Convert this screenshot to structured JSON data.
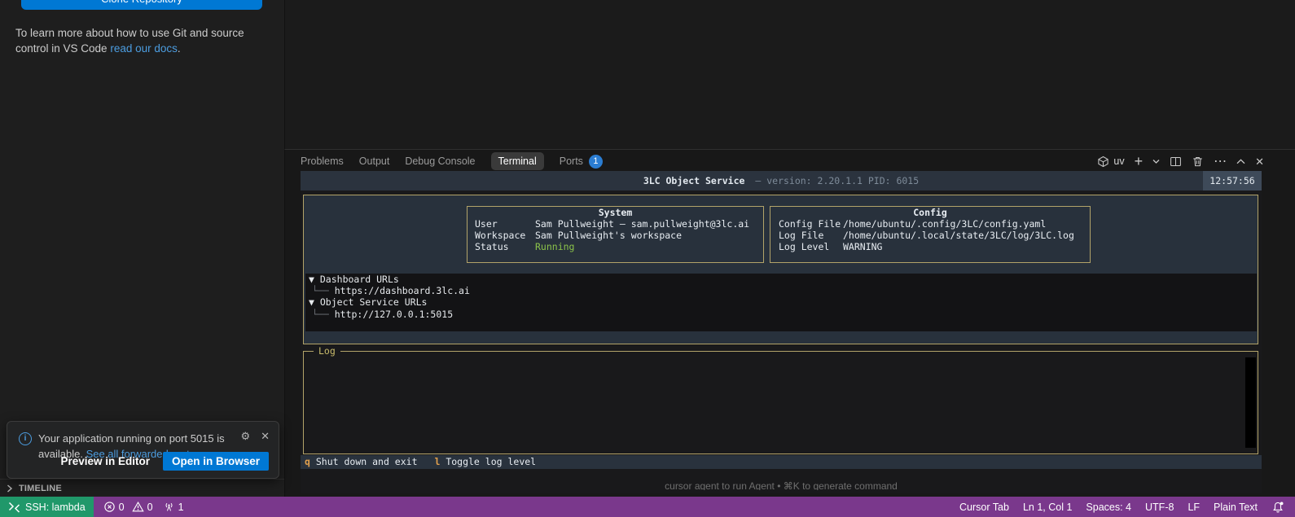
{
  "sidebar": {
    "clone_button": "Clone Repository",
    "git_help_text": "To learn more about how to use Git and source control in VS Code",
    "git_help_link": "read our docs",
    "git_help_suffix": ".",
    "timeline_label": "TIMELINE"
  },
  "notification": {
    "message": "Your application running on port 5015 is available.",
    "link": "See all forwarded ports",
    "secondary_button": "Preview in Editor",
    "primary_button": "Open in Browser"
  },
  "panel": {
    "tabs": [
      {
        "label": "Problems",
        "active": false
      },
      {
        "label": "Output",
        "active": false
      },
      {
        "label": "Debug Console",
        "active": false
      },
      {
        "label": "Terminal",
        "active": true
      },
      {
        "label": "Ports",
        "active": false,
        "badge": "1"
      }
    ],
    "profile_label": "uv"
  },
  "terminal": {
    "header": {
      "title": "3LC Object Service",
      "version_info": "— version: 2.20.1.1 PID: 6015",
      "clock": "12:57:56"
    },
    "system_panel": {
      "title": "System",
      "rows": [
        {
          "label": "User",
          "value": "Sam Pullweight — sam.pullweight@3lc.ai"
        },
        {
          "label": "Workspace",
          "value": "Sam Pullweight's workspace"
        },
        {
          "label": "Status",
          "value": "Running"
        }
      ]
    },
    "config_panel": {
      "title": "Config",
      "rows": [
        {
          "label": "Config File",
          "value": "/home/ubuntu/.config/3LC/config.yaml"
        },
        {
          "label": "Log File",
          "value": "/home/ubuntu/.local/state/3LC/log/3LC.log"
        },
        {
          "label": "Log Level",
          "value": "WARNING"
        }
      ]
    },
    "tree": {
      "items": [
        {
          "prefix": "▼",
          "label": "Dashboard URLs"
        },
        {
          "prefix": "└──",
          "label": "https://dashboard.3lc.ai"
        },
        {
          "prefix": "▼",
          "label": "Object Service URLs"
        },
        {
          "prefix": "└──",
          "label": "http://127.0.0.1:5015"
        }
      ]
    },
    "log_title": "Log",
    "hotkeys": [
      {
        "key": "q",
        "label": "Shut down and exit"
      },
      {
        "key": "l",
        "label": "Toggle log level"
      }
    ],
    "hint": "cursor agent to run Agent • ⌘K to generate command"
  },
  "statusbar": {
    "remote": "SSH: lambda",
    "errors": "0",
    "warnings": "0",
    "ports_count": "1",
    "right": [
      "Cursor Tab",
      "Ln 1, Col 1",
      "Spaces: 4",
      "UTF-8",
      "LF",
      "Plain Text"
    ]
  },
  "colors": {
    "accent_blue": "#0078d4",
    "link_blue": "#4c9de0",
    "badge_blue": "#2b7dd2",
    "remote_green": "#20986a",
    "statusbar_purple": "#7a388c",
    "tui_border_yellow": "#b2a369",
    "tui_panel_slate": "#28313c",
    "running_green": "#8bc34a",
    "hotkey_orange": "#e2a04d"
  }
}
